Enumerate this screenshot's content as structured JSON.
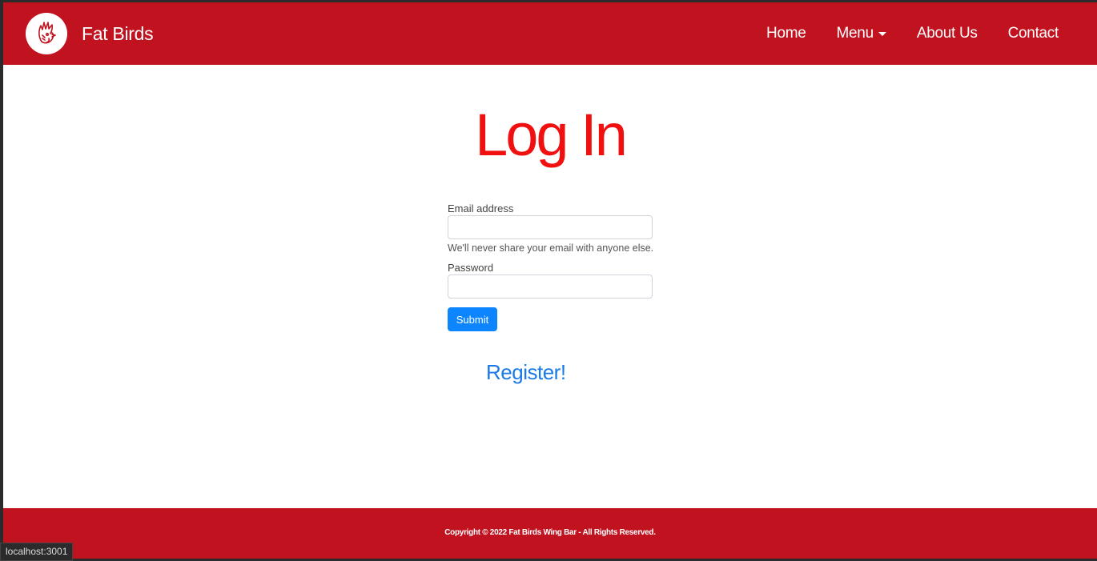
{
  "navbar": {
    "brand": "Fat Birds",
    "links": [
      {
        "label": "Home"
      },
      {
        "label": "Menu"
      },
      {
        "label": "About Us"
      },
      {
        "label": "Contact"
      }
    ]
  },
  "main": {
    "title": "Log In",
    "email_label": "Email address",
    "email_value": "",
    "email_help": "We'll never share your email with anyone else.",
    "password_label": "Password",
    "password_value": "",
    "submit_label": "Submit",
    "register_link": "Register!"
  },
  "footer": {
    "text": "Copyright © 2022 Fat Birds Wing Bar - All Rights Reserved."
  },
  "status_bar": {
    "url": "localhost:3001"
  },
  "colors": {
    "brand_red": "#c1121f",
    "title_red": "#f01010",
    "button_blue": "#0d85ff",
    "link_blue": "#1a7ae6"
  },
  "icons": {
    "logo": "rooster-logo-icon",
    "dropdown": "caret-down-icon"
  }
}
